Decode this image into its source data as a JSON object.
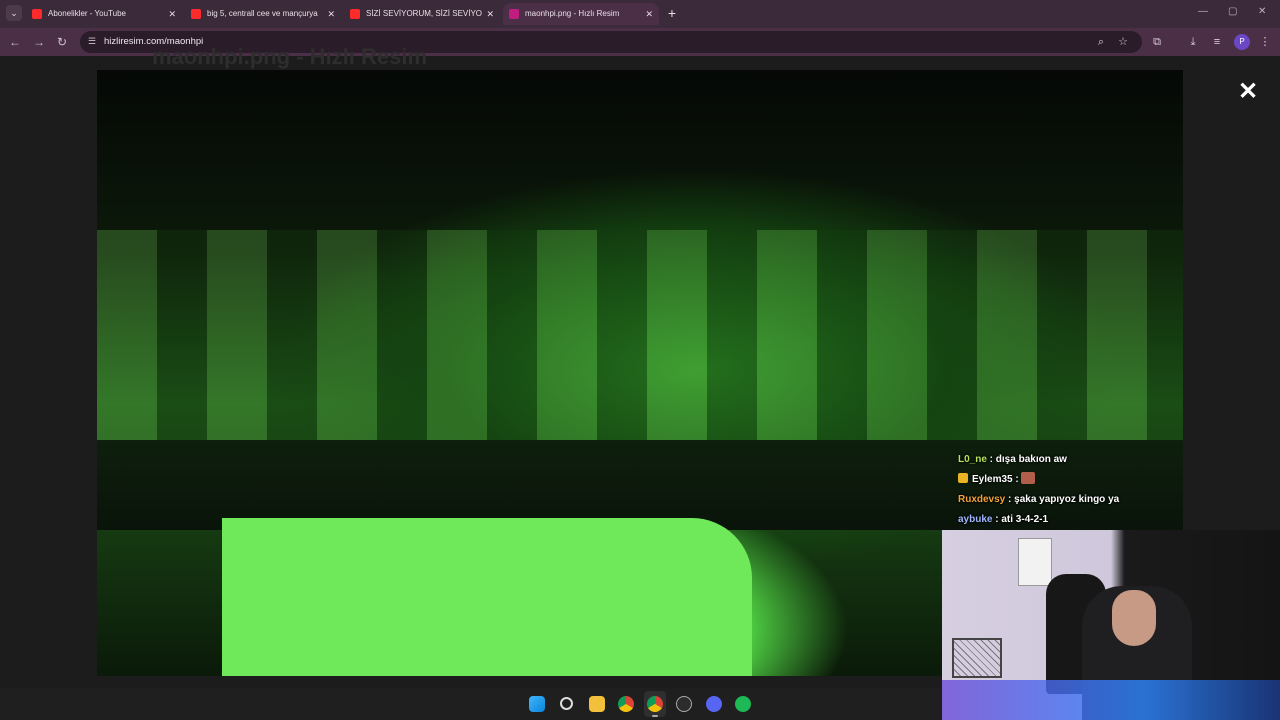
{
  "browser": {
    "tabs": [
      {
        "title": "Abonelikler - YouTube",
        "favicon": "youtube-icon",
        "active": false
      },
      {
        "title": "big 5, centrall cee ve mançurya",
        "favicon": "youtube-icon",
        "active": false
      },
      {
        "title": "SİZİ SEVİYORUM, SİZİ SEVİYORUM",
        "favicon": "youtube-icon",
        "active": false
      },
      {
        "title": "maonhpi.png - Hızlı Resim",
        "favicon": "hizliresim-icon",
        "active": true
      }
    ],
    "address": "hizliresim.com/maonhpi",
    "profile_initial": "P"
  },
  "viewer": {
    "ghost_title": "maonhpi.png - Hızlı Resim",
    "image_name": "maonhpi.png"
  },
  "chat": [
    {
      "user": "L0_ne",
      "sep": " : ",
      "message": "dışa bakıon aw",
      "color": "#b6e45a",
      "badge": false,
      "emote": false
    },
    {
      "user": "Eylem35",
      "sep": " : ",
      "message": "",
      "color": "#ffffff",
      "badge": true,
      "emote": true
    },
    {
      "user": "Ruxdevsy",
      "sep": " : ",
      "message": "şaka yapıyoz kingo ya",
      "color": "#f2a33c",
      "badge": false,
      "emote": false
    },
    {
      "user": "aybuke",
      "sep": " : ",
      "message": "ati 3-4-2-1",
      "color": "#9fb7ff",
      "badge": false,
      "emote": false
    }
  ],
  "taskbar": {
    "apps": [
      "windows-start-icon",
      "search-icon",
      "file-explorer-icon",
      "chrome-icon",
      "chrome-active-icon",
      "app-icon",
      "discord-icon",
      "spotify-icon"
    ]
  },
  "colors": {
    "tab_strip": "#3b2a3a",
    "toolbar": "#4a2f47",
    "viewer_bg": "#1c1c1c"
  }
}
